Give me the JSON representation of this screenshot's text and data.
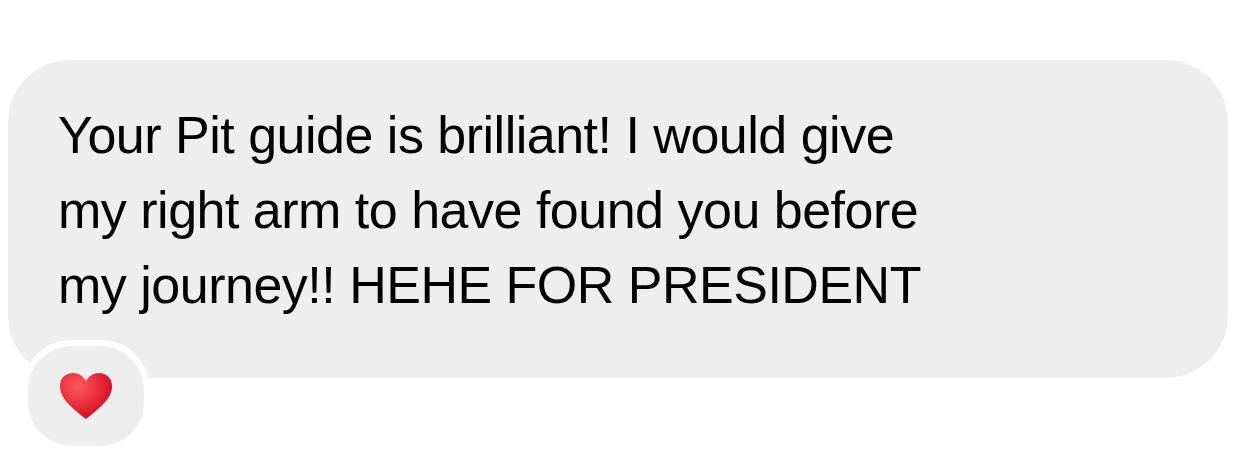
{
  "message": {
    "lines": [
      "Your Pit guide is brilliant! I would give",
      "my right arm to have found you before",
      "my journey!! HEHE FOR PRESIDENT"
    ],
    "reaction": {
      "kind": "heart"
    }
  }
}
